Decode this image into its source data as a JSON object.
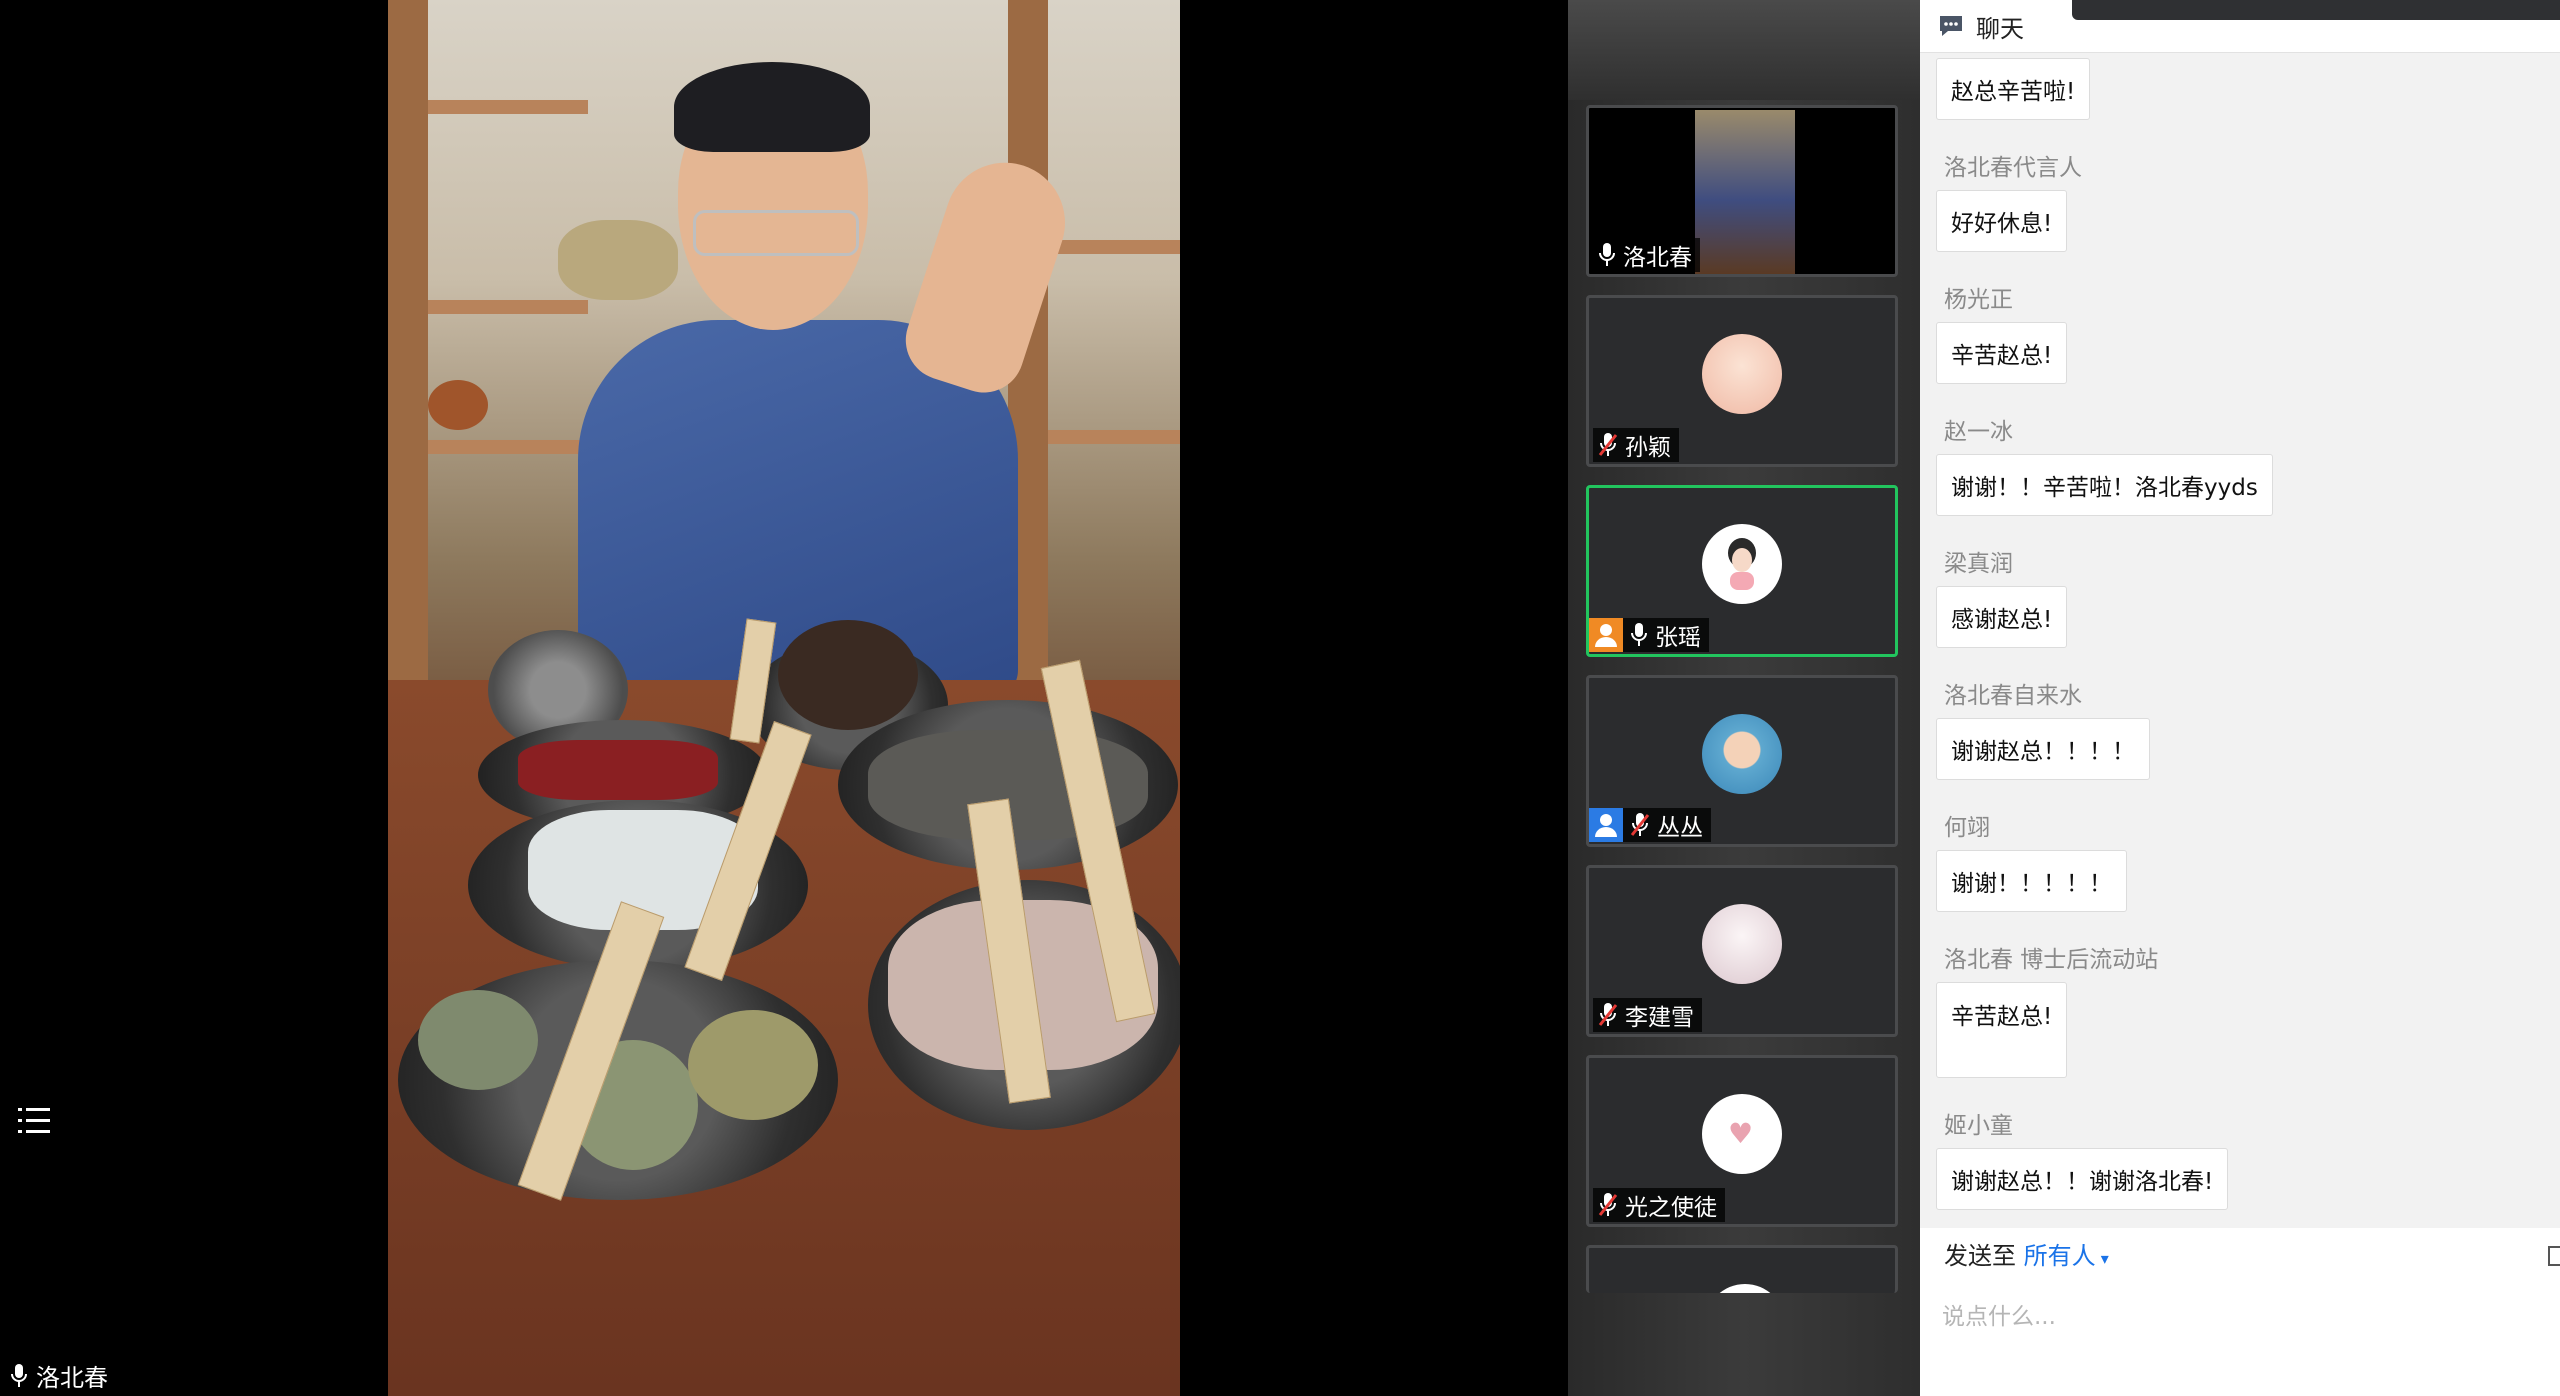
{
  "main": {
    "speaker_name": "洛北春",
    "menu_icon": "list-icon"
  },
  "participants": [
    {
      "name": "洛北春",
      "mic": "on",
      "active": false,
      "host": false,
      "video": true
    },
    {
      "name": "孙颖",
      "mic": "muted",
      "active": false,
      "host": false,
      "avatar_color": "#f3c9b6"
    },
    {
      "name": "张瑶",
      "mic": "on",
      "active": true,
      "host": true,
      "host_color": "#f08a24",
      "avatar_color": "#ffffff"
    },
    {
      "name": "丛丛",
      "mic": "muted",
      "active": false,
      "host": true,
      "host_color": "#2b7be4",
      "avatar_color": "#6ab6d8"
    },
    {
      "name": "李建雪",
      "mic": "muted",
      "active": false,
      "host": false,
      "avatar_color": "#e8dfe3"
    },
    {
      "name": "光之使徒",
      "mic": "muted",
      "active": false,
      "host": false,
      "avatar_color": "#ffffff"
    }
  ],
  "chat": {
    "title": "聊天",
    "messages": [
      {
        "sender": "",
        "text": "赵总辛苦啦!"
      },
      {
        "sender": "洛北春代言人",
        "text": "好好休息!"
      },
      {
        "sender": "杨光正",
        "text": "辛苦赵总!"
      },
      {
        "sender": "赵一冰",
        "text": "谢谢！！辛苦啦！洛北春yyds"
      },
      {
        "sender": "梁真润",
        "text": "感谢赵总!"
      },
      {
        "sender": "洛北春自来水",
        "text": "谢谢赵总！！！！"
      },
      {
        "sender": "何翊",
        "text": "谢谢！！！！！"
      },
      {
        "sender": "洛北春 博士后流动站",
        "text": "辛苦赵总!"
      },
      {
        "sender": "姬小童",
        "text": "谢谢赵总！！谢谢洛北春!"
      }
    ],
    "send_to_label": "发送至",
    "send_to_target": "所有人",
    "input_placeholder": "说点什么..."
  },
  "colors": {
    "active_border": "#22c55e",
    "link": "#1a73e8",
    "muted_mic": "#e53935"
  }
}
